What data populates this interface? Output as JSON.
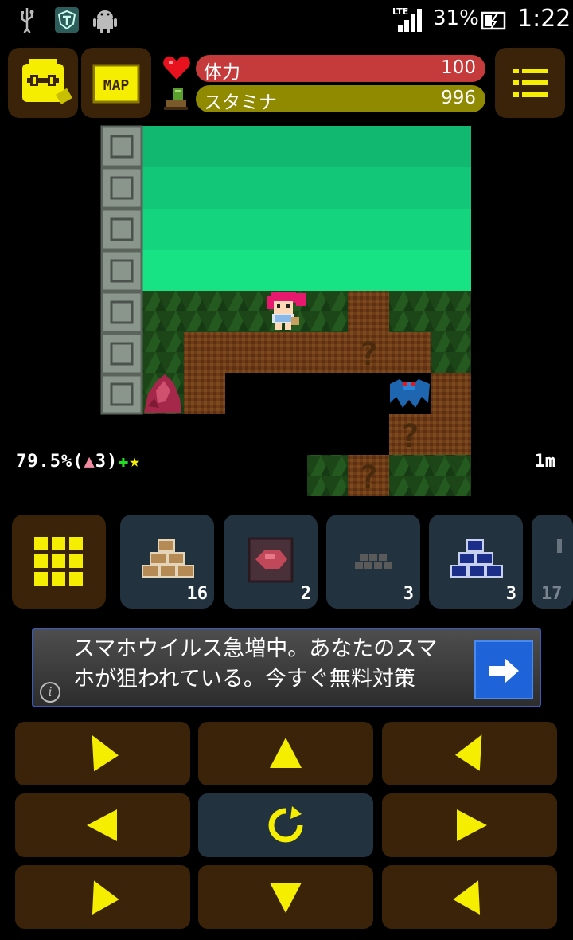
{
  "status_bar": {
    "network": "LTE",
    "battery": "31%",
    "time": "1:22"
  },
  "hud": {
    "map_label": "MAP",
    "hp_label": "体力",
    "hp_value": "100",
    "stamina_label": "スタミナ",
    "stamina_value": "996"
  },
  "game": {
    "progress": "79.5%(",
    "progress_level": "3",
    "progress_tail": ")",
    "depth": "1m"
  },
  "slots": [
    {
      "icon": "brown-block-pyramid-icon",
      "count": "16"
    },
    {
      "icon": "red-ore-block-icon",
      "count": "2"
    },
    {
      "icon": "gray-brick-icon",
      "count": "3"
    },
    {
      "icon": "blue-block-pyramid-icon",
      "count": "3"
    },
    {
      "icon": "partial-slot-icon",
      "count": "17"
    }
  ],
  "ad": {
    "text_line1": "スマホウイルス急増中。あなたのスマ",
    "text_line2": "ホが狙われている。今すぐ無料対策",
    "info": "i"
  },
  "colors": {
    "panel_brown": "#3a2308",
    "panel_slate": "#23323f",
    "arrow_yellow": "#f5ee00",
    "hp_red": "#c53a3a",
    "stamina_olive": "#8f8a00",
    "water_green": "#17e07f",
    "grass_green": "#1f4d1b",
    "dirt_brown": "#6b3a14"
  }
}
